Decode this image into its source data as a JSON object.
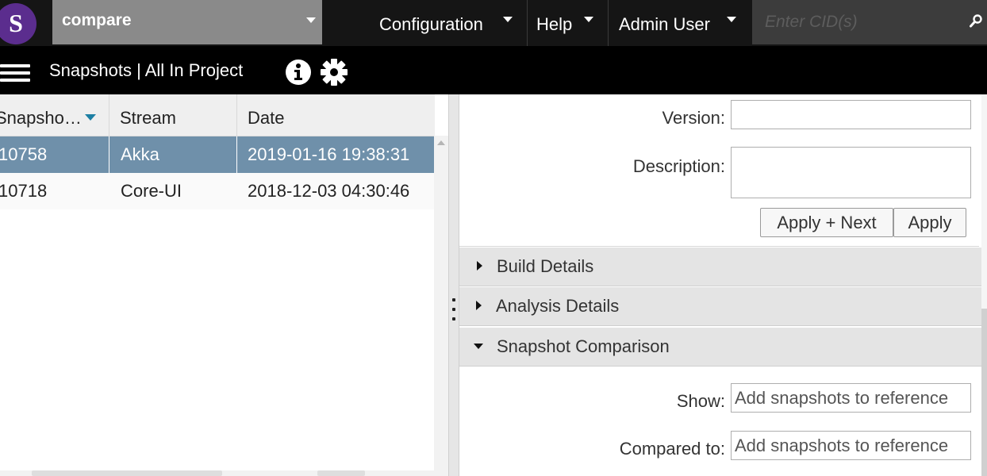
{
  "app": {
    "logo_letter": "S",
    "project": "compare"
  },
  "nav": {
    "configuration": "Configuration",
    "help": "Help",
    "admin": "Admin User",
    "cid_placeholder": "Enter CID(s)"
  },
  "subbar": {
    "title": "Snapshots | All In Project"
  },
  "table": {
    "headers": [
      "Snapsho…",
      "Stream",
      "Date"
    ],
    "rows": [
      {
        "id": "10758",
        "stream": "Akka",
        "date": "2019-01-16 19:38:31",
        "selected": true
      },
      {
        "id": "10718",
        "stream": "Core-UI",
        "date": "2018-12-03 04:30:46",
        "selected": false
      }
    ]
  },
  "details": {
    "version_label": "Version:",
    "version_value": "",
    "description_label": "Description:",
    "description_value": "",
    "apply_next": "Apply + Next",
    "apply": "Apply",
    "sections": [
      {
        "label": "Build Details",
        "expanded": false
      },
      {
        "label": "Analysis Details",
        "expanded": false
      },
      {
        "label": "Snapshot Comparison",
        "expanded": true
      }
    ],
    "show_label": "Show:",
    "show_placeholder": "Add snapshots to reference",
    "compared_label": "Compared to:",
    "compared_placeholder": "Add snapshots to reference"
  },
  "colors": {
    "logo": "#5b2d8e",
    "selection": "#6f90aa",
    "sort_indicator": "#1d7fa3"
  }
}
